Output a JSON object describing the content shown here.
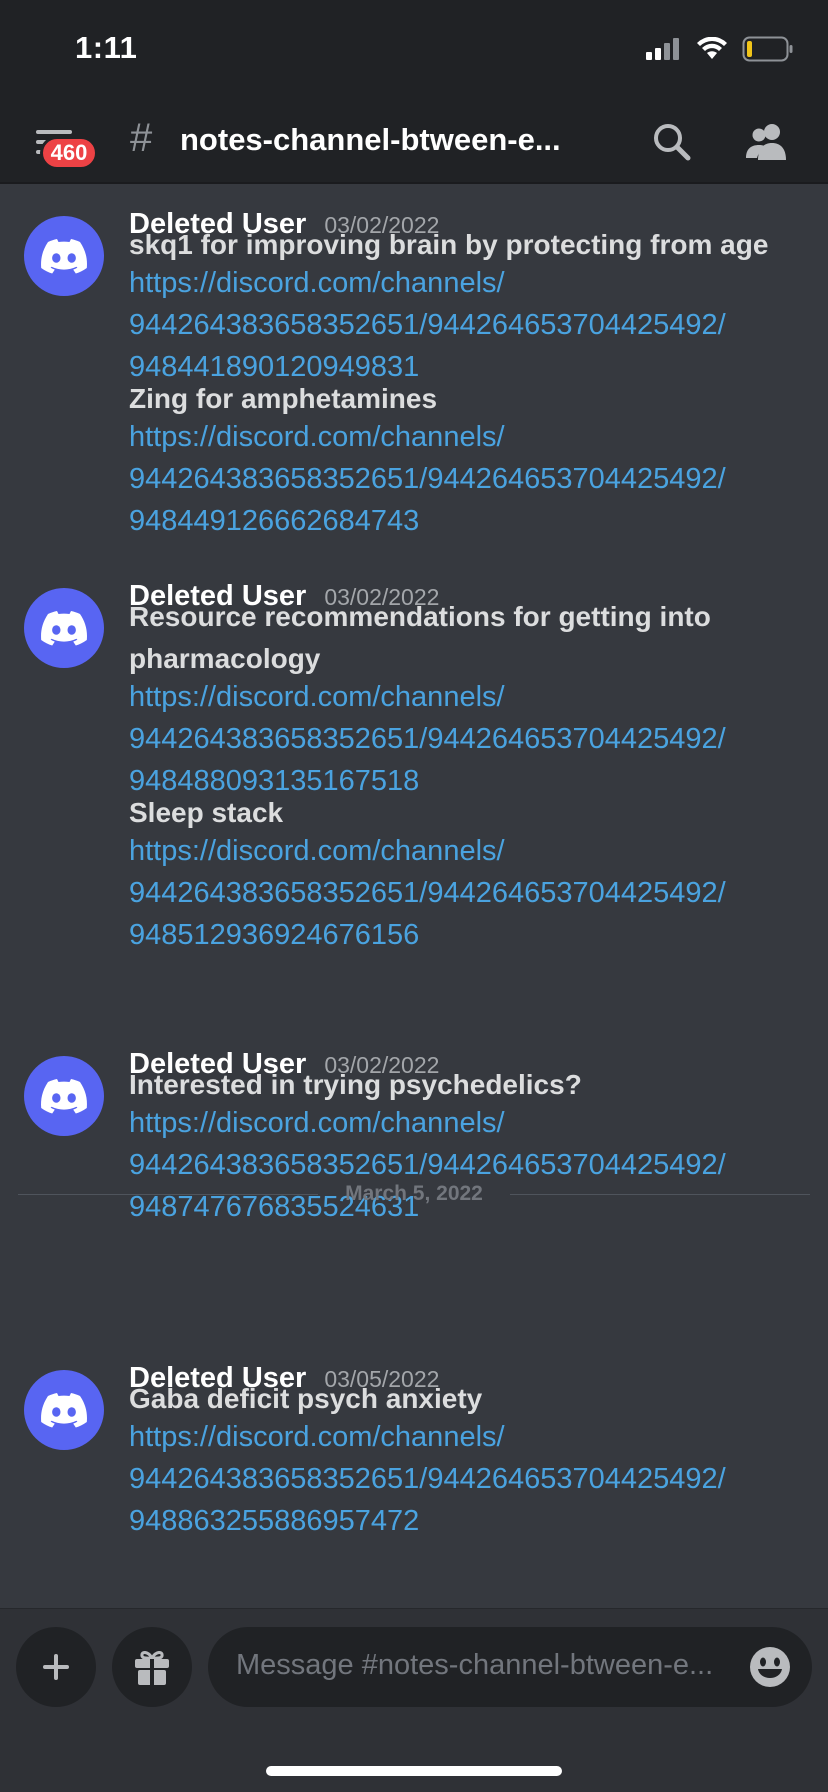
{
  "status_bar": {
    "time": "1:11",
    "icons": [
      "cellular-signal-icon",
      "wifi-icon",
      "battery-low-icon"
    ]
  },
  "header": {
    "menu_icon": "hamburger-menu-icon",
    "unread_badge": "460",
    "channel_prefix": "#",
    "channel_name": "notes-channel-btween-e...",
    "search_icon": "search-icon",
    "members_icon": "members-icon"
  },
  "messages": [
    {
      "username": "Deleted User",
      "timestamp": "03/02/2022",
      "avatar_icon": "discord-logo-icon",
      "items": [
        {
          "text": "skq1 for improving brain by protecting from age",
          "link_lines": [
            "https://discord.com/channels/",
            "944264383658352651/944264653704425492/",
            "948441890120949831"
          ]
        },
        {
          "text": "Zing for amphetamines",
          "link_lines": [
            "https://discord.com/channels/",
            "944264383658352651/944264653704425492/",
            "948449126662684743"
          ]
        }
      ]
    },
    {
      "username": "Deleted User",
      "timestamp": "03/02/2022",
      "avatar_icon": "discord-logo-icon",
      "items": [
        {
          "text_lines": [
            "Resource recommendations for getting into",
            "pharmacology"
          ],
          "link_lines": [
            "https://discord.com/channels/",
            "944264383658352651/944264653704425492/",
            "948488093135167518"
          ]
        },
        {
          "text": "Sleep stack",
          "link_lines": [
            "https://discord.com/channels/",
            "944264383658352651/944264653704425492/",
            "948512936924676156"
          ]
        }
      ]
    },
    {
      "username": "Deleted User",
      "timestamp": "03/02/2022",
      "avatar_icon": "discord-logo-icon",
      "items": [
        {
          "text": "Interested in trying psychedelics?",
          "link_lines": [
            "https://discord.com/channels/",
            "944264383658352651/944264653704425492/",
            "948747676835524631"
          ]
        }
      ]
    },
    {
      "username": "Deleted User",
      "timestamp": "03/05/2022",
      "avatar_icon": "discord-logo-icon",
      "items": [
        {
          "text": "Gaba deficit psych anxiety",
          "link_lines": [
            "https://discord.com/channels/",
            "944264383658352651/944264653704425492/",
            "948863255886957472"
          ]
        }
      ]
    }
  ],
  "date_divider": "March 5, 2022",
  "composer": {
    "add_icon": "plus-icon",
    "gift_icon": "gift-icon",
    "placeholder": "Message #notes-channel-btween-e...",
    "emoji_icon": "emoji-smile-icon"
  },
  "colors": {
    "background": "#36393f",
    "header": "#202225",
    "link": "#4aa3e0",
    "blurple": "#5865f2",
    "badge": "#ed4245"
  }
}
